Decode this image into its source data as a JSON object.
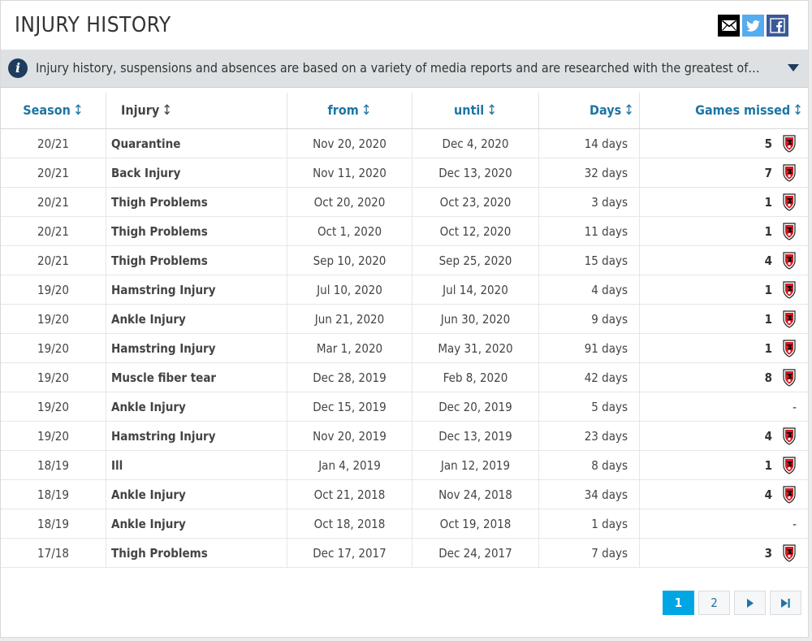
{
  "header": {
    "title": "INJURY HISTORY",
    "share": {
      "email_icon": "envelope-icon",
      "twitter_icon": "twitter-icon",
      "facebook_icon": "facebook-icon"
    }
  },
  "info": {
    "icon": "info-icon",
    "text": "Injury history, suspensions and absences are based on a variety of media reports and are researched with the greatest of care. If you should notice any errors, please contact us."
  },
  "table": {
    "columns": {
      "season": "Season",
      "injury": "Injury",
      "from": "from",
      "until": "until",
      "days": "Days",
      "games": "Games missed"
    },
    "sort_glyph": "↕",
    "rows": [
      {
        "season": "20/21",
        "injury": "Quarantine",
        "from": "Nov 20, 2020",
        "until": "Dec 4, 2020",
        "days": "14 days",
        "games": "5",
        "club": true
      },
      {
        "season": "20/21",
        "injury": "Back Injury",
        "from": "Nov 11, 2020",
        "until": "Dec 13, 2020",
        "days": "32 days",
        "games": "7",
        "club": true
      },
      {
        "season": "20/21",
        "injury": "Thigh Problems",
        "from": "Oct 20, 2020",
        "until": "Oct 23, 2020",
        "days": "3 days",
        "games": "1",
        "club": true
      },
      {
        "season": "20/21",
        "injury": "Thigh Problems",
        "from": "Oct 1, 2020",
        "until": "Oct 12, 2020",
        "days": "11 days",
        "games": "1",
        "club": true
      },
      {
        "season": "20/21",
        "injury": "Thigh Problems",
        "from": "Sep 10, 2020",
        "until": "Sep 25, 2020",
        "days": "15 days",
        "games": "4",
        "club": true
      },
      {
        "season": "19/20",
        "injury": "Hamstring Injury",
        "from": "Jul 10, 2020",
        "until": "Jul 14, 2020",
        "days": "4 days",
        "games": "1",
        "club": true
      },
      {
        "season": "19/20",
        "injury": "Ankle Injury",
        "from": "Jun 21, 2020",
        "until": "Jun 30, 2020",
        "days": "9 days",
        "games": "1",
        "club": true
      },
      {
        "season": "19/20",
        "injury": "Hamstring Injury",
        "from": "Mar 1, 2020",
        "until": "May 31, 2020",
        "days": "91 days",
        "games": "1",
        "club": true
      },
      {
        "season": "19/20",
        "injury": "Muscle fiber tear",
        "from": "Dec 28, 2019",
        "until": "Feb 8, 2020",
        "days": "42 days",
        "games": "8",
        "club": true
      },
      {
        "season": "19/20",
        "injury": "Ankle Injury",
        "from": "Dec 15, 2019",
        "until": "Dec 20, 2019",
        "days": "5 days",
        "games": "-",
        "club": false
      },
      {
        "season": "19/20",
        "injury": "Hamstring Injury",
        "from": "Nov 20, 2019",
        "until": "Dec 13, 2019",
        "days": "23 days",
        "games": "4",
        "club": true
      },
      {
        "season": "18/19",
        "injury": "Ill",
        "from": "Jan 4, 2019",
        "until": "Jan 12, 2019",
        "days": "8 days",
        "games": "1",
        "club": true
      },
      {
        "season": "18/19",
        "injury": "Ankle Injury",
        "from": "Oct 21, 2018",
        "until": "Nov 24, 2018",
        "days": "34 days",
        "games": "4",
        "club": true
      },
      {
        "season": "18/19",
        "injury": "Ankle Injury",
        "from": "Oct 18, 2018",
        "until": "Oct 19, 2018",
        "days": "1 days",
        "games": "-",
        "club": false
      },
      {
        "season": "17/18",
        "injury": "Thigh Problems",
        "from": "Dec 17, 2017",
        "until": "Dec 24, 2017",
        "days": "7 days",
        "games": "3",
        "club": true
      }
    ]
  },
  "pagination": {
    "pages": [
      "1",
      "2"
    ],
    "current": "1",
    "next_icon": "triangle-right-icon",
    "last_icon": "skip-to-end-icon"
  },
  "colors": {
    "link_blue": "#1d75a3",
    "active_page": "#00a6e3",
    "info_bar": "#dde1e3"
  }
}
